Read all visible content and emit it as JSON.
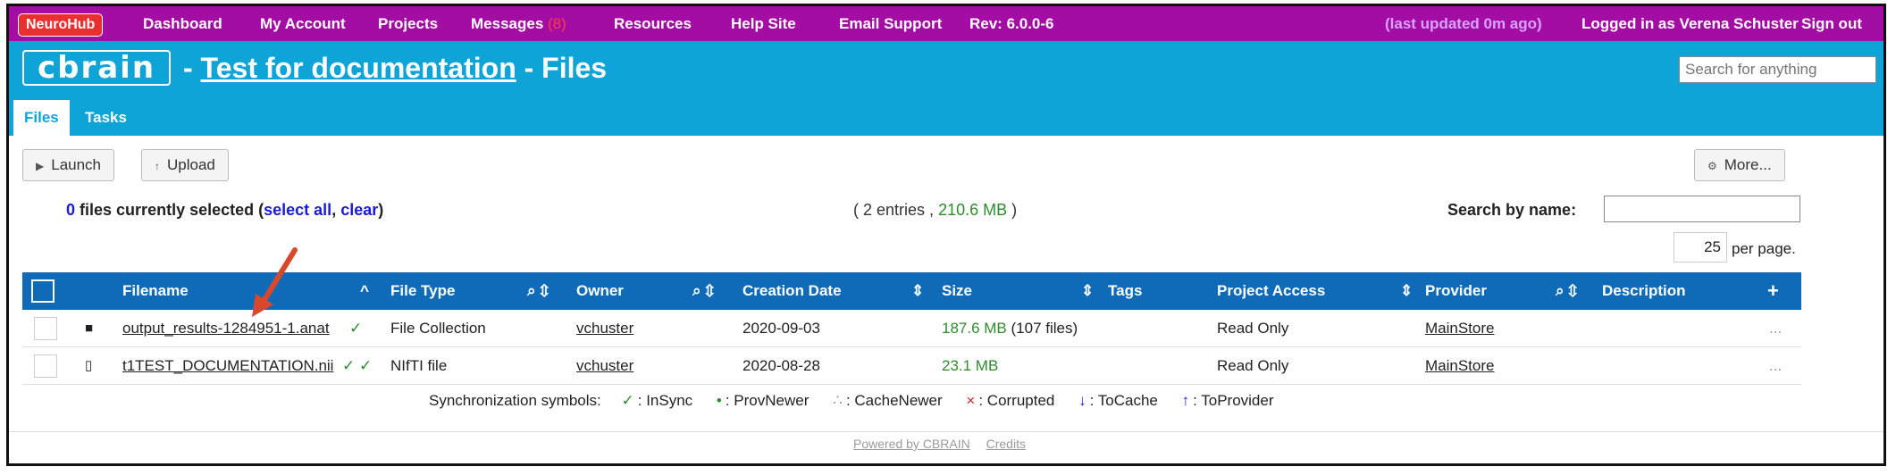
{
  "topbar": {
    "brand": "NeuroHub",
    "items": [
      "Dashboard",
      "My Account",
      "Projects",
      "Messages",
      "Resources",
      "Help Site",
      "Email Support"
    ],
    "messages_count": "(8)",
    "revision": "Rev: 6.0.0-6",
    "last_updated": "(last updated 0m ago)",
    "logged_in": "Logged in as Verena Schuster",
    "sign_out": "Sign out"
  },
  "header": {
    "logo": "cbrain",
    "sep1": "-",
    "project": "Test for documentation",
    "sep2": "- Files",
    "search_placeholder": "Search for anything",
    "tabs": [
      "Files",
      "Tasks"
    ]
  },
  "toolbar": {
    "launch": "Launch",
    "upload": "Upload",
    "more": "More..."
  },
  "selection": {
    "count": "0",
    "text": "files currently selected (",
    "select_all": "select all",
    "comma": ",",
    "clear": "clear",
    "close": ")"
  },
  "summary": {
    "open": "( 2 entries ,",
    "size": "210.6 MB",
    "close": ")"
  },
  "search_by_name": "Search by name:",
  "per_page": {
    "value": "25",
    "label": "per page."
  },
  "table": {
    "headers": [
      "Filename",
      "File Type",
      "Owner",
      "Creation Date",
      "Size",
      "Tags",
      "Project Access",
      "Provider",
      "Description"
    ],
    "rows": [
      {
        "icon": "folder-icon",
        "filename": "output_results-1284951-1.anat",
        "sync": "✓",
        "file_type": "File Collection",
        "owner": "vchuster",
        "date": "2020-09-03",
        "size": "187.6 MB",
        "size_extra": "(107 files)",
        "access": "Read Only",
        "provider": "MainStore",
        "more": "..."
      },
      {
        "icon": "file-icon",
        "filename": "t1TEST_DOCUMENTATION.nii",
        "sync": "✓ ✓",
        "file_type": "NIfTI file",
        "owner": "vchuster",
        "date": "2020-08-28",
        "size": "23.1 MB",
        "size_extra": "",
        "access": "Read Only",
        "provider": "MainStore",
        "more": "..."
      }
    ]
  },
  "sync_legend": {
    "label": "Synchronization symbols:",
    "items": [
      {
        "sym": "✓",
        "text": ": InSync",
        "color": "#2e8b2e"
      },
      {
        "sym": "•",
        "text": ": ProvNewer",
        "color": "#2e8b2e"
      },
      {
        "sym": "∴",
        "text": ": CacheNewer",
        "color": "#999999"
      },
      {
        "sym": "×",
        "text": ": Corrupted",
        "color": "#e02020"
      },
      {
        "sym": "↓",
        "text": ": ToCache",
        "color": "#1a1adb"
      },
      {
        "sym": "↑",
        "text": ": ToProvider",
        "color": "#1a1adb"
      }
    ]
  },
  "footer": {
    "powered": "Powered by CBRAIN",
    "credits": "Credits"
  },
  "colors": {
    "topbar": "#a30da3",
    "header": "#0ea4d8",
    "table_header": "#0f6bb7",
    "annotation_arrow": "#d9482b"
  }
}
